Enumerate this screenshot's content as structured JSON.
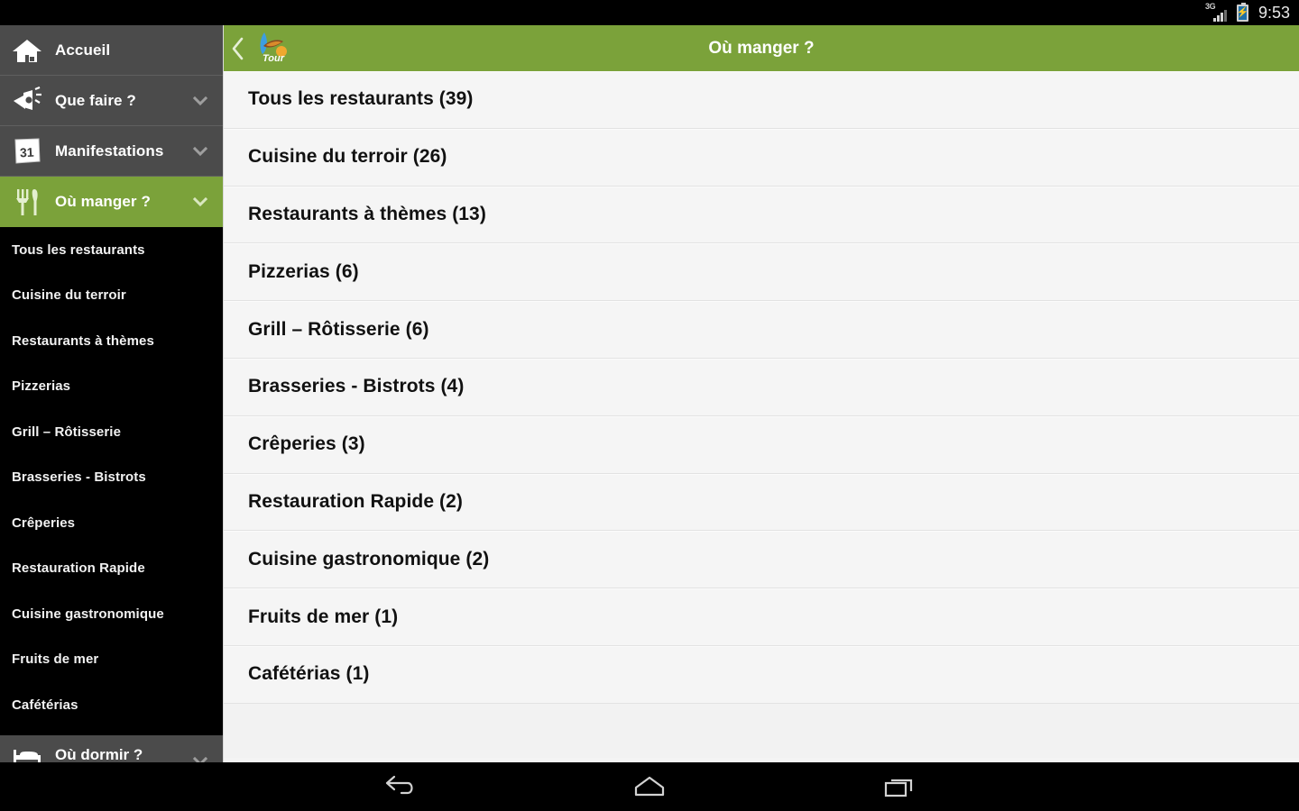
{
  "statusbar": {
    "network_label": "3G",
    "signal_icon": "signal-bars-icon",
    "battery_icon": "battery-charging-icon",
    "time": "9:53"
  },
  "sidebar": {
    "main_items": [
      {
        "label": "Accueil",
        "icon": "home-icon",
        "expandable": false,
        "active": false
      },
      {
        "label": "Que faire ?",
        "icon": "megaphone-icon",
        "expandable": true,
        "active": false
      },
      {
        "label": "Manifestations",
        "icon": "calendar-31-icon",
        "expandable": true,
        "active": false
      },
      {
        "label": "Où manger ?",
        "icon": "cutlery-icon",
        "expandable": true,
        "active": true
      }
    ],
    "sub_items": [
      {
        "label": "Tous les restaurants"
      },
      {
        "label": "Cuisine du terroir"
      },
      {
        "label": "Restaurants à thèmes"
      },
      {
        "label": "Pizzerias"
      },
      {
        "label": "Grill – Rôtisserie"
      },
      {
        "label": "Brasseries - Bistrots"
      },
      {
        "label": "Crêperies"
      },
      {
        "label": "Restauration Rapide"
      },
      {
        "label": "Cuisine gastronomique"
      },
      {
        "label": "Fruits de mer"
      },
      {
        "label": "Cafétérias"
      }
    ],
    "cut_item": {
      "label": "Où dormir ?",
      "icon": "bed-icon",
      "expandable": true
    }
  },
  "topbar": {
    "back_icon": "chevron-left-icon",
    "logo_icon": "tour-logo-icon",
    "logo_text": "Tour",
    "title": "Où manger ?",
    "accent_color": "#7ba23a"
  },
  "list": {
    "rows": [
      {
        "label": "Tous les restaurants (39)"
      },
      {
        "label": "Cuisine du terroir (26)"
      },
      {
        "label": "Restaurants à thèmes (13)"
      },
      {
        "label": "Pizzerias (6)"
      },
      {
        "label": "Grill – Rôtisserie (6)"
      },
      {
        "label": "Brasseries - Bistrots (4)"
      },
      {
        "label": "Crêperies (3)"
      },
      {
        "label": "Restauration Rapide (2)"
      },
      {
        "label": "Cuisine gastronomique (2)"
      },
      {
        "label": "Fruits de mer (1)"
      },
      {
        "label": "Cafétérias (1)"
      }
    ]
  },
  "navbar": {
    "buttons": [
      {
        "icon": "back-arrow-icon"
      },
      {
        "icon": "home-outline-icon"
      },
      {
        "icon": "recent-apps-icon"
      }
    ]
  }
}
